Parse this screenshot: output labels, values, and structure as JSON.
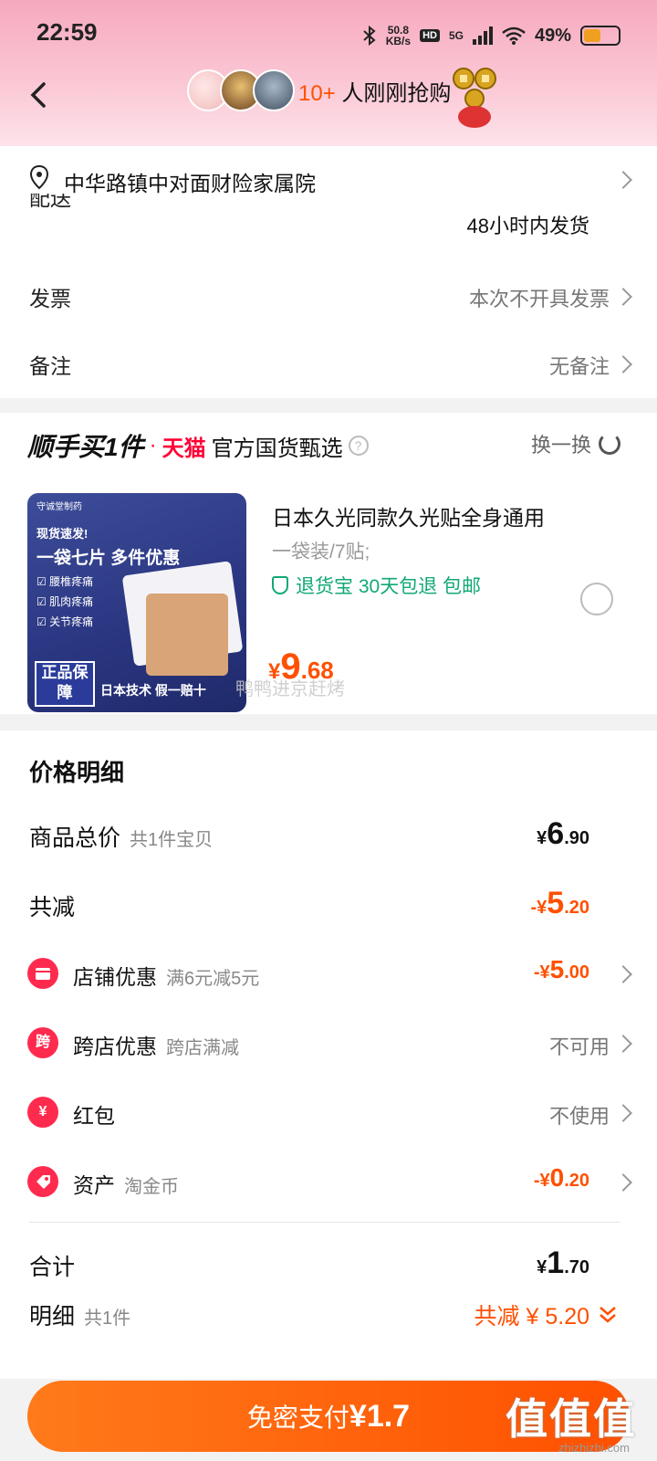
{
  "status_bar": {
    "time": "22:59",
    "net_speed_value": "50.8",
    "net_speed_unit": "KB/s",
    "hd_label": "HD",
    "network": "5G",
    "battery_text": "49%",
    "battery_level": 0.49
  },
  "header": {
    "rush_count": "10+",
    "rush_text": " 人刚刚抢购"
  },
  "address": {
    "text": "中华路镇中对面财险家属院"
  },
  "delivery": {
    "label": "配送",
    "value": "48小时内发货"
  },
  "invoice": {
    "label": "发票",
    "value": "本次不开具发票"
  },
  "remark": {
    "label": "备注",
    "value": "无备注"
  },
  "bundle": {
    "title": "顺手买1件",
    "dot": "·",
    "tmall": "天猫",
    "subtitle": "官方国货甄选",
    "help": "?",
    "swap_label": "换一换",
    "product": {
      "name": "日本久光同款久光贴全身通用",
      "spec": "一袋装/7贴;",
      "guarantee": "退货宝  30天包退  包邮",
      "price_symbol": "¥",
      "price_int": "9",
      "price_dec": ".68",
      "watermark_text": "鸭鸭进京赶烤",
      "image": {
        "logo": "守诚堂制药",
        "line1": "现货速发!",
        "line2": "一袋七片  多件优惠",
        "checks": [
          "☑ 腰椎疼痛",
          "☑ 肌肉疼痛",
          "☑ 关节疼痛"
        ],
        "badge": "正品保障",
        "footer": "日本技术 假一赔十"
      }
    }
  },
  "price_detail": {
    "title": "价格明细",
    "total": {
      "label": "商品总价",
      "sub": "共1件宝贝",
      "y": "¥",
      "int": "6",
      "dec": ".90"
    },
    "reduce": {
      "label": "共减",
      "y": "-¥",
      "int": "5",
      "dec": ".20"
    },
    "store": {
      "label": "店铺优惠",
      "sub": "满6元减5元",
      "y": "-¥",
      "int": "5",
      "dec": ".00"
    },
    "cross": {
      "label": "跨店优惠",
      "sub": "跨店满减",
      "value": "不可用",
      "icon_text": "跨"
    },
    "redpack": {
      "label": "红包",
      "value": "不使用",
      "icon_text": "¥"
    },
    "asset": {
      "label": "资产",
      "sub": "淘金币",
      "y": "-¥",
      "int": "0",
      "dec": ".20"
    },
    "sum": {
      "label": "合计",
      "y": "¥",
      "int": "1",
      "dec": ".70"
    },
    "detail": {
      "label": "明细",
      "sub": "共1件",
      "value": "共减 ¥ 5.20"
    }
  },
  "pay_button": {
    "label": "免密支付",
    "amount": "¥1.7"
  },
  "watermark": {
    "big": "值值值",
    "small": "zhizhizhi.com"
  },
  "colors": {
    "accent": "#ff5000",
    "tmall": "#ff0036",
    "guarantee": "#12a876",
    "header_pink": "#f6a9be"
  }
}
